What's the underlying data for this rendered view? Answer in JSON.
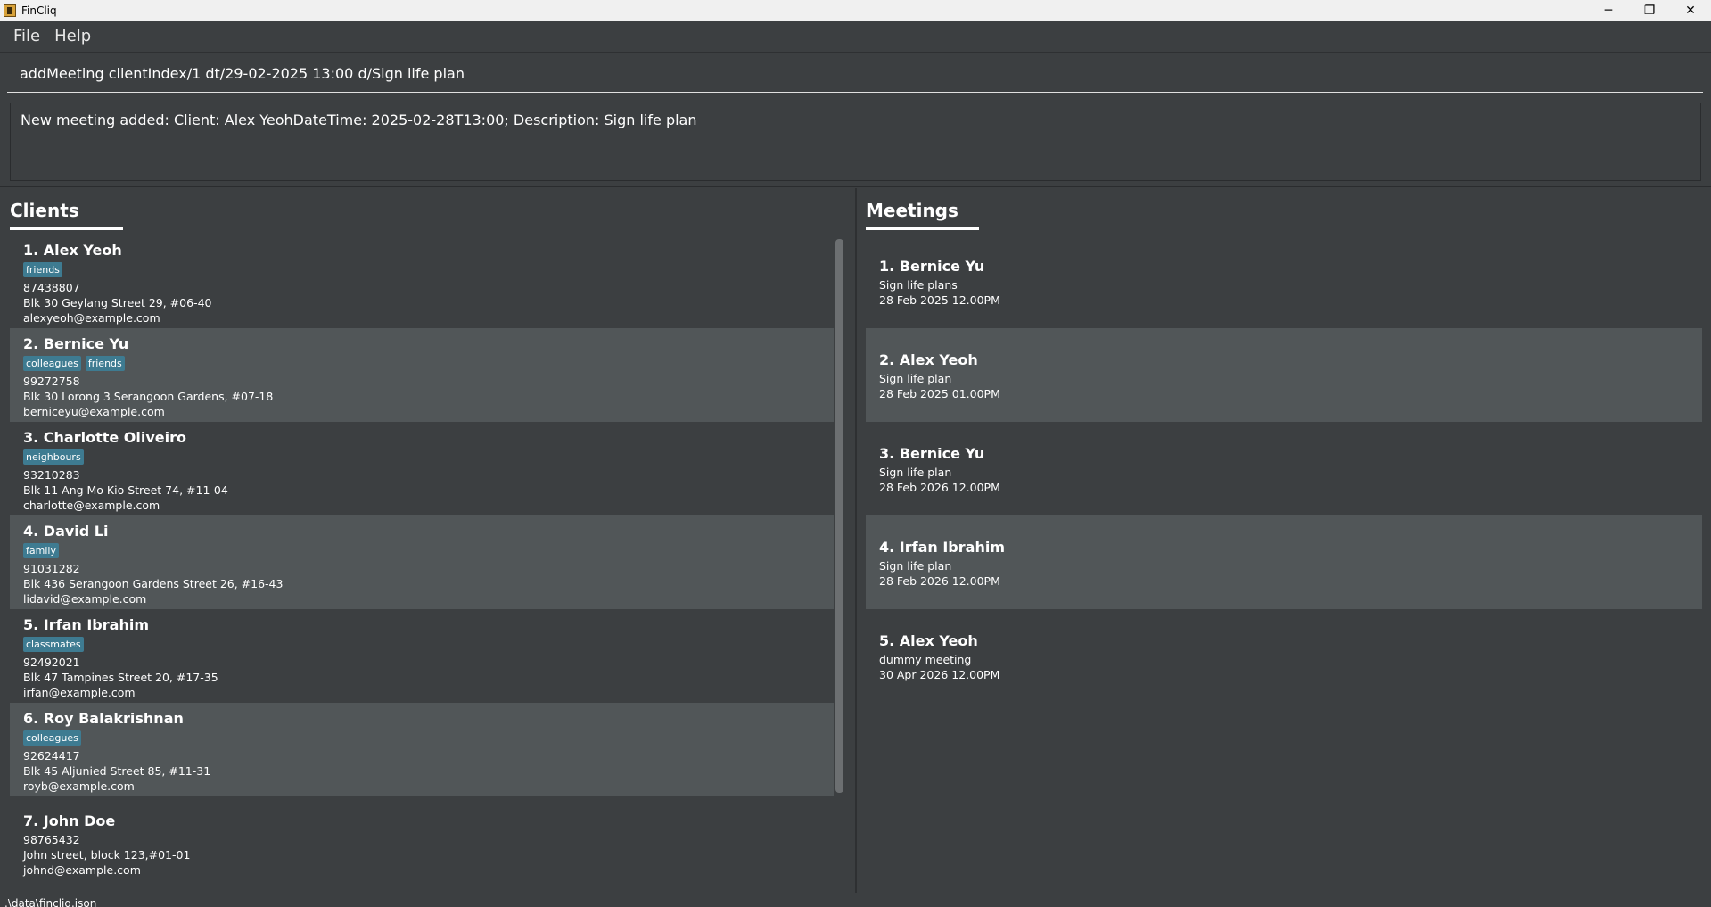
{
  "window": {
    "title": "FinCliq",
    "minimize_glyph": "─",
    "maximize_glyph": "❐",
    "close_glyph": "✕"
  },
  "menu": {
    "file": "File",
    "help": "Help"
  },
  "command": {
    "value": "addMeeting clientIndex/1 dt/29-02-2025 13:00 d/Sign life plan"
  },
  "result": {
    "text": "New meeting added: Client: Alex YeohDateTime: 2025-02-28T13:00; Description: Sign life plan"
  },
  "clients_panel": {
    "title": "Clients",
    "clients": [
      {
        "name": "1.  Alex Yeoh",
        "tags": [
          "friends"
        ],
        "phone": "87438807",
        "address": "Blk 30 Geylang Street 29, #06-40",
        "email": "alexyeoh@example.com"
      },
      {
        "name": "2.  Bernice Yu",
        "tags": [
          "colleagues",
          "friends"
        ],
        "phone": "99272758",
        "address": "Blk 30 Lorong 3 Serangoon Gardens, #07-18",
        "email": "berniceyu@example.com"
      },
      {
        "name": "3.  Charlotte Oliveiro",
        "tags": [
          "neighbours"
        ],
        "phone": "93210283",
        "address": "Blk 11 Ang Mo Kio Street 74, #11-04",
        "email": "charlotte@example.com"
      },
      {
        "name": "4.  David Li",
        "tags": [
          "family"
        ],
        "phone": "91031282",
        "address": "Blk 436 Serangoon Gardens Street 26, #16-43",
        "email": "lidavid@example.com"
      },
      {
        "name": "5.  Irfan Ibrahim",
        "tags": [
          "classmates"
        ],
        "phone": "92492021",
        "address": "Blk 47 Tampines Street 20, #17-35",
        "email": "irfan@example.com"
      },
      {
        "name": "6.  Roy Balakrishnan",
        "tags": [
          "colleagues"
        ],
        "phone": "92624417",
        "address": "Blk 45 Aljunied Street 85, #11-31",
        "email": "royb@example.com"
      },
      {
        "name": "7.  John Doe",
        "tags": [],
        "phone": "98765432",
        "address": "John street, block 123,#01-01",
        "email": "johnd@example.com"
      }
    ]
  },
  "meetings_panel": {
    "title": "Meetings",
    "meetings": [
      {
        "name": "1.  Bernice Yu",
        "description": "Sign life plans",
        "datetime": "28 Feb 2025 12.00PM"
      },
      {
        "name": "2.  Alex Yeoh",
        "description": "Sign life plan",
        "datetime": "28 Feb 2025 01.00PM"
      },
      {
        "name": "3.  Bernice Yu",
        "description": "Sign life plan",
        "datetime": "28 Feb 2026 12.00PM"
      },
      {
        "name": "4.  Irfan Ibrahim",
        "description": "Sign life plan",
        "datetime": "28 Feb 2026 12.00PM"
      },
      {
        "name": "5.  Alex Yeoh",
        "description": "dummy meeting",
        "datetime": "30 Apr 2026 12.00PM"
      }
    ]
  },
  "status": {
    "path": ".\\data\\fincliq.json"
  },
  "colors": {
    "background": "#3c3f41",
    "card_alt": "#515658",
    "tag": "#3e7b91"
  }
}
